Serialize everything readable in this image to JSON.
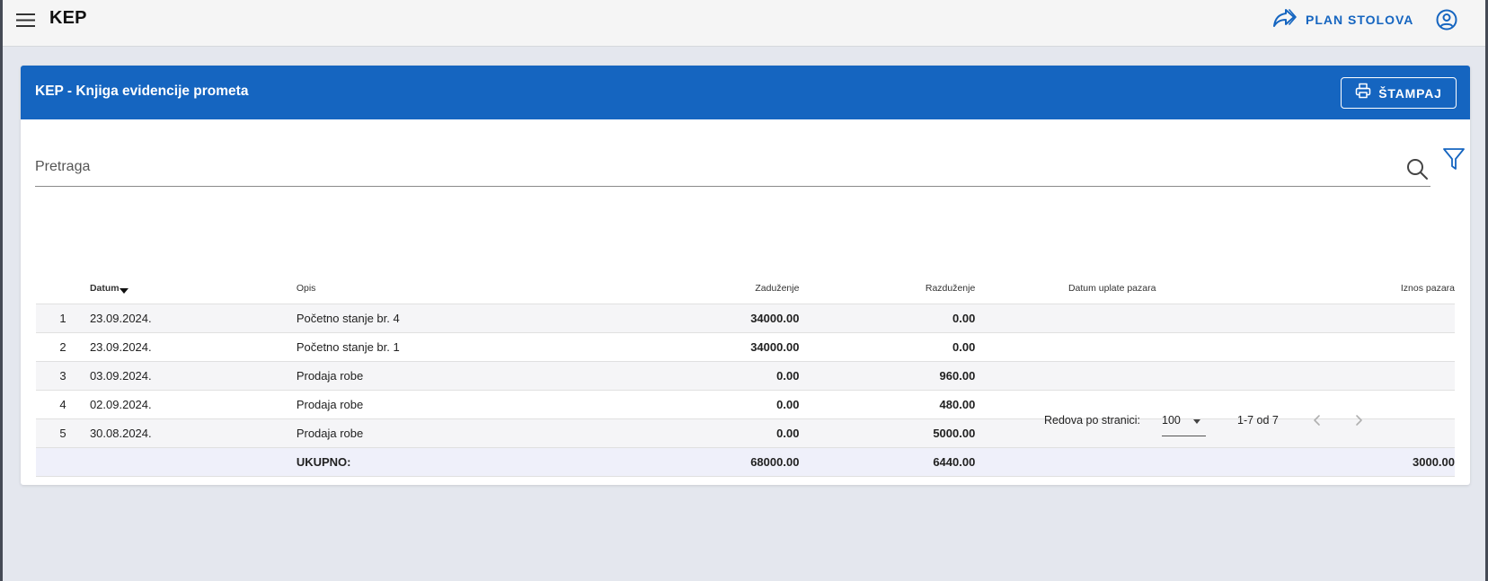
{
  "app": {
    "title": "KEP"
  },
  "topbar": {
    "plan_label": "PLAN STOLOVA"
  },
  "card": {
    "title": "KEP - Knjiga evidencije prometa",
    "print_label": "ŠTAMPAJ"
  },
  "search": {
    "placeholder": "Pretraga",
    "value": ""
  },
  "table": {
    "headers": {
      "datum": "Datum",
      "opis": "Opis",
      "zaduzenje": "Zaduženje",
      "razduzenje": "Razduženje",
      "datum_uplate": "Datum uplate pazara",
      "iznos": "Iznos pazara"
    },
    "rows": [
      {
        "num": "1",
        "datum": "23.09.2024.",
        "opis": "Početno stanje br. 4",
        "zaduzenje": "34000.00",
        "razduzenje": "0.00",
        "datum_uplate": "",
        "iznos": ""
      },
      {
        "num": "2",
        "datum": "23.09.2024.",
        "opis": "Početno stanje br. 1",
        "zaduzenje": "34000.00",
        "razduzenje": "0.00",
        "datum_uplate": "",
        "iznos": ""
      },
      {
        "num": "3",
        "datum": "03.09.2024.",
        "opis": "Prodaja robe",
        "zaduzenje": "0.00",
        "razduzenje": "960.00",
        "datum_uplate": "",
        "iznos": ""
      },
      {
        "num": "4",
        "datum": "02.09.2024.",
        "opis": "Prodaja robe",
        "zaduzenje": "0.00",
        "razduzenje": "480.00",
        "datum_uplate": "",
        "iznos": ""
      },
      {
        "num": "5",
        "datum": "30.08.2024.",
        "opis": "Prodaja robe",
        "zaduzenje": "0.00",
        "razduzenje": "5000.00",
        "datum_uplate": "",
        "iznos": ""
      }
    ],
    "total": {
      "label": "UKUPNO:",
      "zaduzenje": "68000.00",
      "razduzenje": "6440.00",
      "iznos": "3000.00"
    }
  },
  "pagination": {
    "rows_label": "Redova po stranici:",
    "rows_value": "100",
    "range": "1-7 od 7"
  },
  "colors": {
    "primary": "#1565c0",
    "positive": "#43a047",
    "negative": "#ef3b3b",
    "background": "#e4e7ee"
  }
}
